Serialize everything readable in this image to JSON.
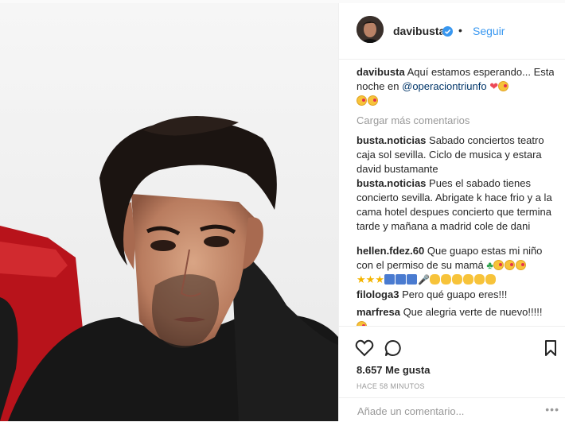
{
  "header": {
    "username": "davibusta",
    "follow_label": "Seguir",
    "separator": "•"
  },
  "caption": {
    "username": "davibusta",
    "text_1": "Aquí estamos esperando... Esta noche en",
    "mention": "@operaciontriunfo"
  },
  "load_more": "Cargar más comentarios",
  "comments": [
    {
      "username": "busta.noticias",
      "text": "Sabado conciertos teatro caja sol sevilla. Ciclo de musica y estara david bustamante"
    },
    {
      "username": "busta.noticias",
      "text": "Pues el sabado tienes concierto sevilla. Abrigate k hace frio y a la cama hotel despues concierto que termina tarde y mañana a madrid cole de dani"
    },
    {
      "username": "hellen.fdez.60",
      "text": "Que guapo estas mi niño con el permiso de su mamá"
    },
    {
      "username": "filologa3",
      "text": "Pero qué guapo eres!!!"
    },
    {
      "username": "marfresa",
      "text": "Que alegria verte de nuevo!!!!!"
    }
  ],
  "likes": "8.657 Me gusta",
  "timestamp": "HACE 58 MINUTOS",
  "add_comment_placeholder": "Añade un comentario...",
  "more_options": "•••",
  "colors": {
    "link": "#3897f0",
    "mention": "#003569",
    "muted": "#999999",
    "heart": "#ed4956"
  }
}
